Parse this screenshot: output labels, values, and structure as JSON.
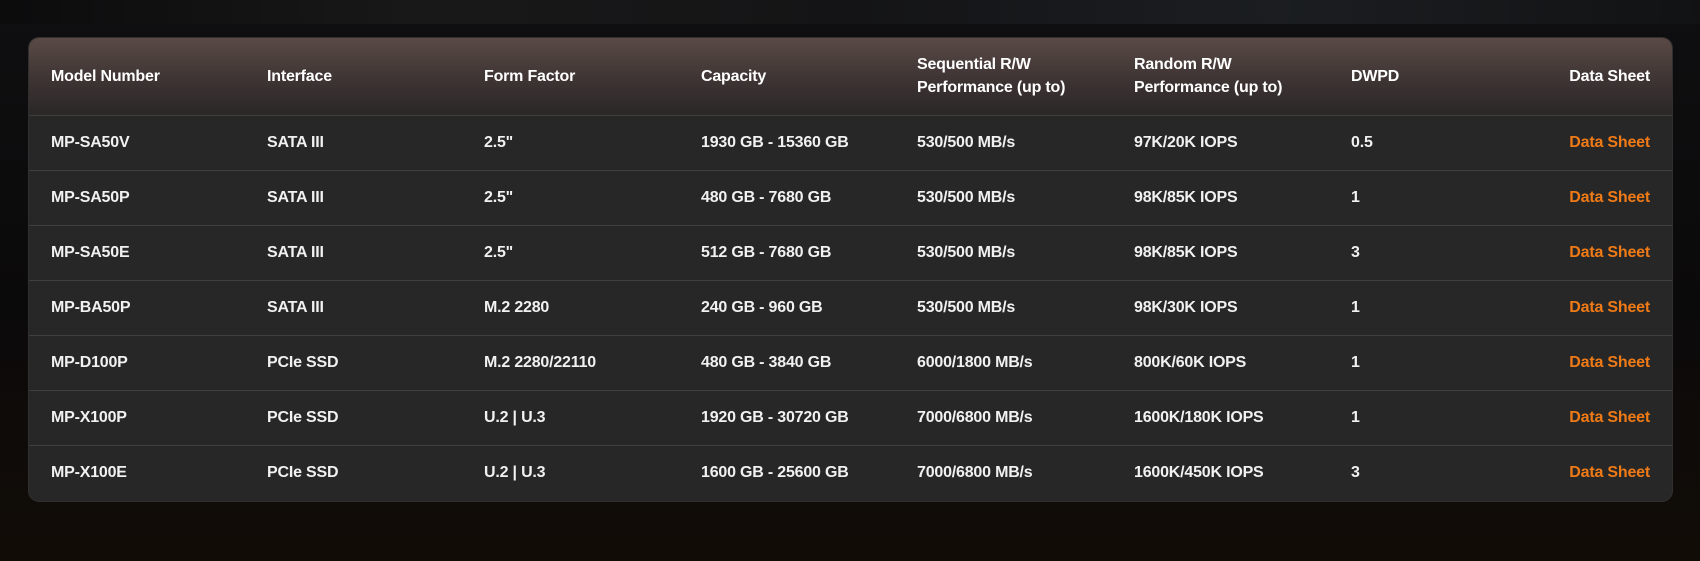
{
  "table": {
    "headers": {
      "model": "Model Number",
      "interface": "Interface",
      "form_factor": "Form Factor",
      "capacity": "Capacity",
      "sequential": "Sequential  R/W Performance (up to)",
      "random": "Random  R/W Performance (up to)",
      "dwpd": "DWPD",
      "datasheet": "Data Sheet"
    },
    "rows": [
      {
        "model": "MP-SA50V",
        "interface": "SATA III",
        "form_factor": "2.5\"",
        "capacity": "1930 GB  - 15360 GB",
        "sequential": "530/500  MB/s",
        "random": "97K/20K  IOPS",
        "dwpd": "0.5",
        "datasheet": "Data Sheet"
      },
      {
        "model": "MP-SA50P",
        "interface": "SATA III",
        "form_factor": "2.5\"",
        "capacity": "480 GB  - 7680 GB",
        "sequential": "530/500  MB/s",
        "random": "98K/85K  IOPS",
        "dwpd": "1",
        "datasheet": "Data Sheet"
      },
      {
        "model": "MP-SA50E",
        "interface": "SATA III",
        "form_factor": "2.5\"",
        "capacity": "512 GB  - 7680 GB",
        "sequential": "530/500  MB/s",
        "random": "98K/85K  IOPS",
        "dwpd": "3",
        "datasheet": "Data Sheet"
      },
      {
        "model": "MP-BA50P",
        "interface": "SATA III",
        "form_factor": "M.2  2280",
        "capacity": "240 GB  - 960 GB",
        "sequential": "530/500  MB/s",
        "random": "98K/30K  IOPS",
        "dwpd": "1",
        "datasheet": "Data Sheet"
      },
      {
        "model": "MP-D100P",
        "interface": "PCIe SSD",
        "form_factor": "M.2  2280/22110",
        "capacity": "480 GB  - 3840 GB",
        "sequential": "6000/1800  MB/s",
        "random": "800K/60K  IOPS",
        "dwpd": "1",
        "datasheet": "Data Sheet"
      },
      {
        "model": "MP-X100P",
        "interface": "PCIe SSD",
        "form_factor": "U.2 |  U.3",
        "capacity": "1920 GB  - 30720 GB",
        "sequential": "7000/6800  MB/s",
        "random": "1600K/180K  IOPS",
        "dwpd": "1",
        "datasheet": "Data Sheet"
      },
      {
        "model": "MP-X100E",
        "interface": "PCIe SSD",
        "form_factor": "U.2 |  U.3",
        "capacity": "1600 GB  - 25600 GB",
        "sequential": "7000/6800  MB/s",
        "random": "1600K/450K  IOPS",
        "dwpd": "3",
        "datasheet": "Data Sheet"
      }
    ]
  },
  "colors": {
    "link_accent": "#f07a16",
    "header_top": "#5a4a46",
    "body_bg": "#272727"
  }
}
